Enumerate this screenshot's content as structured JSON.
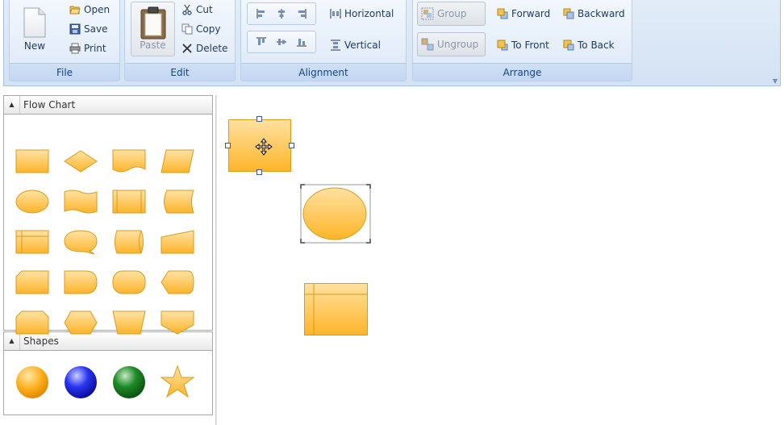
{
  "ribbon": {
    "file": {
      "label": "File",
      "new_label": "New",
      "open_label": "Open",
      "save_label": "Save",
      "print_label": "Print"
    },
    "edit": {
      "label": "Edit",
      "paste_label": "Paste",
      "cut_label": "Cut",
      "copy_label": "Copy",
      "delete_label": "Delete"
    },
    "alignment": {
      "label": "Alignment",
      "horizontal_label": "Horizontal",
      "vertical_label": "Vertical"
    },
    "arrange": {
      "label": "Arrange",
      "group_label": "Group",
      "ungroup_label": "Ungroup",
      "forward_label": "Forward",
      "backward_label": "Backward",
      "to_front_label": "To Front",
      "to_back_label": "To Back"
    }
  },
  "palette": {
    "flow_chart": {
      "title": "Flow Chart",
      "shapes": [
        "process",
        "decision",
        "document",
        "data",
        "terminator-ellipse",
        "punched-tape",
        "predefined-process",
        "stored-data",
        "internal-storage",
        "card-callout",
        "direct-data",
        "manual-input",
        "card",
        "delay",
        "display-rounded",
        "display",
        "loop-limit",
        "preparation",
        "manual-operation",
        "offpage-connector"
      ]
    },
    "shapes": {
      "title": "Shapes",
      "items": [
        "orange-sphere",
        "blue-sphere",
        "green-sphere",
        "star"
      ]
    }
  },
  "colors": {
    "shape_fill_top": "#ffe1a0",
    "shape_fill_bottom": "#fdb528",
    "shape_stroke": "#d89b1a",
    "ribbon_text": "#15428b"
  }
}
